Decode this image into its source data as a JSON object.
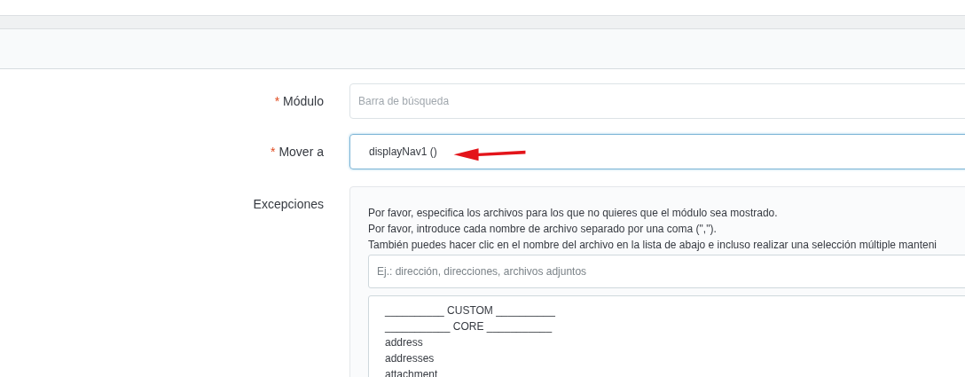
{
  "form": {
    "module": {
      "label": "Módulo",
      "required_mark": "*",
      "placeholder": "Barra de búsqueda"
    },
    "move_to": {
      "label": "Mover a",
      "required_mark": "*",
      "value": "displayNav1 ()",
      "focused": true
    },
    "exceptions": {
      "label": "Excepciones",
      "help": [
        "Por favor, especifica los archivos para los que no quieres que el módulo sea mostrado.",
        "Por favor, introduce cada nombre de archivo separado por una coma (\",\").",
        "También puedes hacer clic en el nombre del archivo en la lista de abajo e incluso realizar una selección múltiple manteni"
      ],
      "placeholder": "Ej.: dirección, direcciones, archivos adjuntos",
      "files": [
        "__________ CUSTOM __________",
        "___________ CORE ___________",
        "address",
        "addresses",
        "attachment"
      ]
    }
  }
}
